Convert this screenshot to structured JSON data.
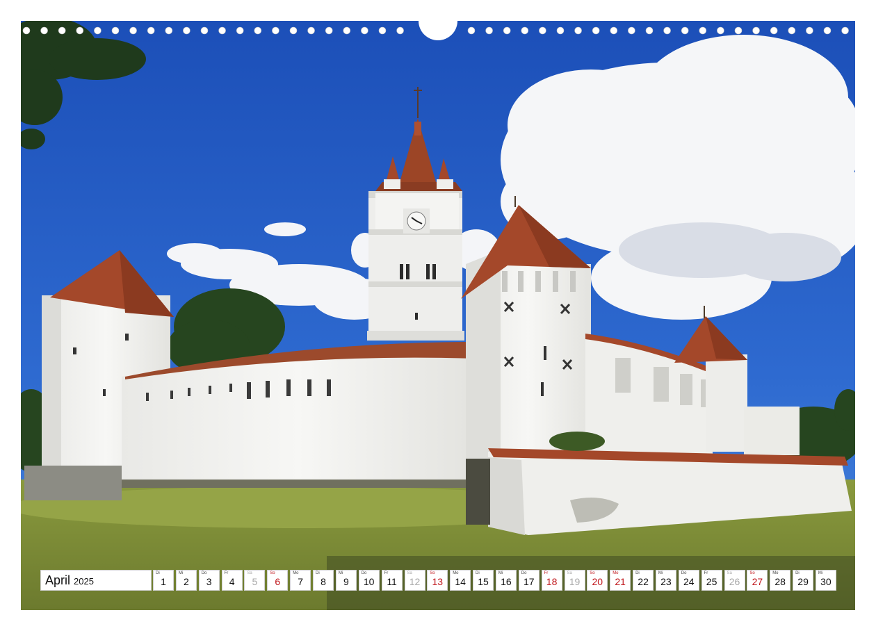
{
  "calendar": {
    "month": "April",
    "year": "2025",
    "days": [
      {
        "weekday": "Di",
        "day": "1",
        "type": "weekday"
      },
      {
        "weekday": "Mi",
        "day": "2",
        "type": "weekday"
      },
      {
        "weekday": "Do",
        "day": "3",
        "type": "weekday"
      },
      {
        "weekday": "Fr",
        "day": "4",
        "type": "weekday"
      },
      {
        "weekday": "Sa",
        "day": "5",
        "type": "sat"
      },
      {
        "weekday": "So",
        "day": "6",
        "type": "sun"
      },
      {
        "weekday": "Mo",
        "day": "7",
        "type": "weekday"
      },
      {
        "weekday": "Di",
        "day": "8",
        "type": "weekday"
      },
      {
        "weekday": "Mi",
        "day": "9",
        "type": "weekday"
      },
      {
        "weekday": "Do",
        "day": "10",
        "type": "weekday"
      },
      {
        "weekday": "Fr",
        "day": "11",
        "type": "weekday"
      },
      {
        "weekday": "Sa",
        "day": "12",
        "type": "sat"
      },
      {
        "weekday": "So",
        "day": "13",
        "type": "sun"
      },
      {
        "weekday": "Mo",
        "day": "14",
        "type": "weekday"
      },
      {
        "weekday": "Di",
        "day": "15",
        "type": "weekday"
      },
      {
        "weekday": "Mi",
        "day": "16",
        "type": "weekday"
      },
      {
        "weekday": "Do",
        "day": "17",
        "type": "weekday"
      },
      {
        "weekday": "Fr",
        "day": "18",
        "type": "sun"
      },
      {
        "weekday": "Sa",
        "day": "19",
        "type": "sat"
      },
      {
        "weekday": "So",
        "day": "20",
        "type": "sun"
      },
      {
        "weekday": "Mo",
        "day": "21",
        "type": "sun"
      },
      {
        "weekday": "Di",
        "day": "22",
        "type": "weekday"
      },
      {
        "weekday": "Mi",
        "day": "23",
        "type": "weekday"
      },
      {
        "weekday": "Do",
        "day": "24",
        "type": "weekday"
      },
      {
        "weekday": "Fr",
        "day": "25",
        "type": "weekday"
      },
      {
        "weekday": "Sa",
        "day": "26",
        "type": "sat"
      },
      {
        "weekday": "So",
        "day": "27",
        "type": "sun"
      },
      {
        "weekday": "Mo",
        "day": "28",
        "type": "weekday"
      },
      {
        "weekday": "Di",
        "day": "29",
        "type": "weekday"
      },
      {
        "weekday": "Mi",
        "day": "30",
        "type": "weekday"
      }
    ]
  },
  "colors": {
    "sky": "#2a63c6",
    "wall": "#f3f3f1",
    "roof": "#a4482a",
    "grass": "#7d8c39",
    "holiday_red": "#c0161b",
    "saturday_grey": "#a8a8a8"
  },
  "photo": {
    "icon": "fortified-church-photo-icon"
  }
}
